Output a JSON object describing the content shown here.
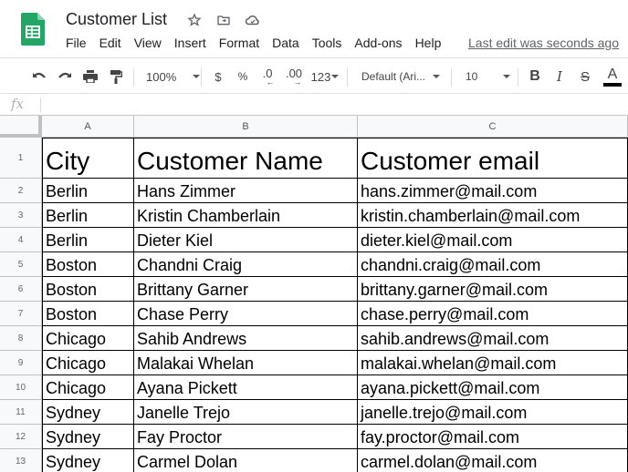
{
  "doc": {
    "title": "Customer List",
    "last_edit": "Last edit was seconds ago",
    "brand_color": "#0F9D58"
  },
  "menu": [
    "File",
    "Edit",
    "View",
    "Insert",
    "Format",
    "Data",
    "Tools",
    "Add-ons",
    "Help"
  ],
  "toolbar": {
    "zoom": "100%",
    "currency": "$",
    "percent": "%",
    "decrease_decimal": ".0",
    "increase_decimal": ".00",
    "more_formats": "123",
    "font": "Default (Ari...",
    "font_size": "10",
    "bold": "B",
    "italic": "I",
    "strikethrough": "S",
    "text_color": "A"
  },
  "formula_bar": {
    "label": "fx",
    "value": ""
  },
  "columns": [
    "A",
    "B",
    "C"
  ],
  "header_row": [
    "City",
    "Customer Name",
    "Customer email"
  ],
  "rows": [
    [
      "Berlin",
      "Hans Zimmer",
      "hans.zimmer@mail.com"
    ],
    [
      "Berlin",
      "Kristin Chamberlain",
      "kristin.chamberlain@mail.com"
    ],
    [
      "Berlin",
      "Dieter Kiel",
      "dieter.kiel@mail.com"
    ],
    [
      "Boston",
      "Chandni Craig",
      "chandni.craig@mail.com"
    ],
    [
      "Boston",
      "Brittany Garner",
      "brittany.garner@mail.com"
    ],
    [
      "Boston",
      "Chase Perry",
      "chase.perry@mail.com"
    ],
    [
      "Chicago",
      "Sahib Andrews",
      "sahib.andrews@mail.com"
    ],
    [
      "Chicago",
      "Malakai Whelan",
      "malakai.whelan@mail.com"
    ],
    [
      "Chicago",
      "Ayana Pickett",
      "ayana.pickett@mail.com"
    ],
    [
      "Sydney",
      "Janelle Trejo",
      "janelle.trejo@mail.com"
    ],
    [
      "Sydney",
      "Fay Proctor",
      "fay.proctor@mail.com"
    ],
    [
      "Sydney",
      "Carmel Dolan",
      "carmel.dolan@mail.com"
    ]
  ],
  "row_numbers": [
    "1",
    "2",
    "3",
    "4",
    "5",
    "6",
    "7",
    "8",
    "9",
    "10",
    "11",
    "12",
    "13"
  ]
}
